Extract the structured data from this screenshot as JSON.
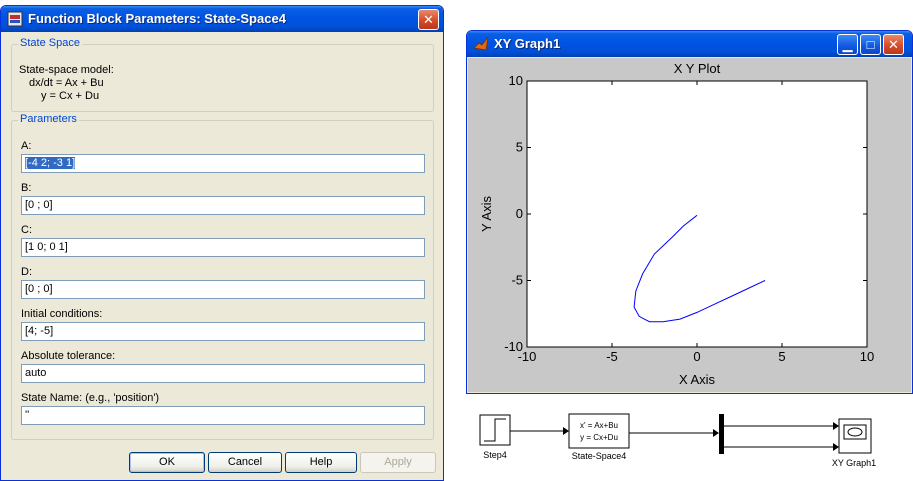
{
  "dialog": {
    "title": "Function Block Parameters: State-Space4",
    "close_glyph": "✕",
    "section_statespace": "State Space",
    "description_line1": "State-space model:",
    "description_line2": "dx/dt = Ax + Bu",
    "description_line3": "y = Cx + Du",
    "section_parameters": "Parameters",
    "params": [
      {
        "label": "A:",
        "value": "[-4 2; -3 1]"
      },
      {
        "label": "B:",
        "value": "[0 ; 0]"
      },
      {
        "label": "C:",
        "value": "[1 0; 0 1]"
      },
      {
        "label": "D:",
        "value": "[0 ; 0]"
      },
      {
        "label": "Initial conditions:",
        "value": "[4; -5]"
      },
      {
        "label": "Absolute tolerance:",
        "value": "auto"
      },
      {
        "label": "State Name: (e.g., 'position')",
        "value": "''"
      }
    ],
    "buttons": {
      "ok": "OK",
      "cancel": "Cancel",
      "help": "Help",
      "apply": "Apply"
    }
  },
  "graph_window": {
    "title": "XY Graph1",
    "minimize_glyph": "▁",
    "maximize_glyph": "□",
    "close_glyph": "✕"
  },
  "chart_data": {
    "type": "line",
    "title": "X Y Plot",
    "xlabel": "X Axis",
    "ylabel": "Y Axis",
    "xlim": [
      -10,
      10
    ],
    "ylim": [
      -10,
      10
    ],
    "xticks": [
      -10,
      -5,
      0,
      5,
      10
    ],
    "yticks": [
      -10,
      -5,
      0,
      5,
      10
    ],
    "grid": false,
    "series": [
      {
        "color": "#0000ff",
        "x": [
          4.0,
          3.0,
          2.0,
          1.0,
          0.0,
          -1.0,
          -2.0,
          -2.8,
          -3.4,
          -3.7,
          -3.6,
          -3.2,
          -2.5,
          -1.5,
          -0.8,
          0.0
        ],
        "y": [
          -5.0,
          -5.6,
          -6.2,
          -6.8,
          -7.4,
          -7.9,
          -8.1,
          -8.1,
          -7.7,
          -7.0,
          -5.8,
          -4.5,
          -3.0,
          -1.8,
          -0.9,
          -0.1
        ]
      }
    ]
  },
  "diagram": {
    "step_label": "Step4",
    "ss_label": "State-Space4",
    "ss_eq1": "x' = Ax+Bu",
    "ss_eq2": "y = Cx+Du",
    "xy_label": "XY Graph1"
  }
}
